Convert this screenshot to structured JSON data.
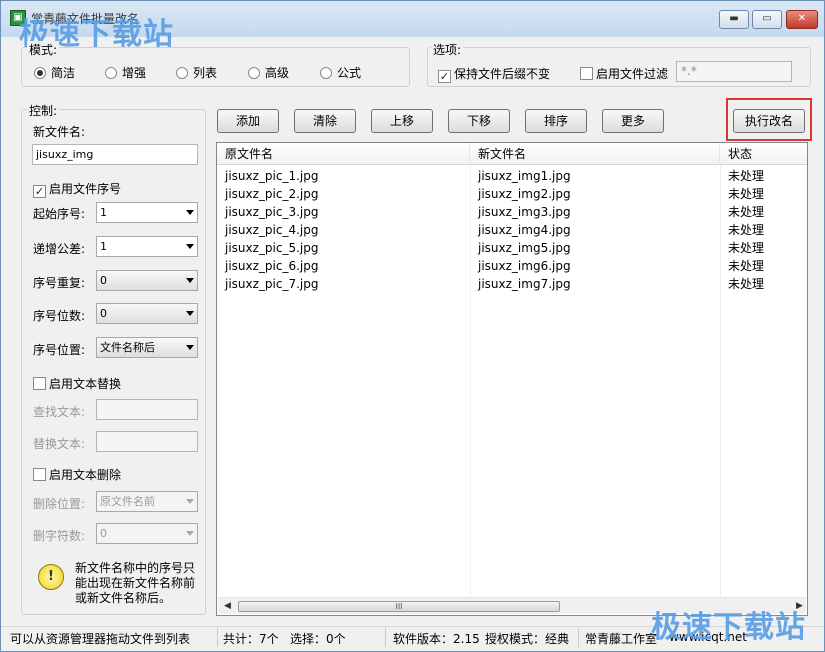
{
  "window": {
    "title": "常青藤文件批量改名",
    "watermark": "极速下载站",
    "controls": {
      "minimize": "▬",
      "maximize": "▭",
      "close": "✕"
    }
  },
  "mode": {
    "legend": "模式:",
    "options": [
      "简洁",
      "增强",
      "列表",
      "高级",
      "公式"
    ],
    "selected": "简洁"
  },
  "options": {
    "legend": "选项:",
    "keep_suffix": {
      "label": "保持文件后缀不变",
      "checked": true
    },
    "enable_filter": {
      "label": "启用文件过滤",
      "checked": false
    },
    "filter_value": "*.*"
  },
  "control": {
    "legend": "控制:",
    "new_name_label": "新文件名:",
    "new_name_value": "jisuxz_img",
    "enable_seq": {
      "label": "启用文件序号",
      "checked": true
    },
    "start_label": "起始序号:",
    "start_value": "1",
    "step_label": "递增公差:",
    "step_value": "1",
    "repeat_label": "序号重复:",
    "repeat_value": "0",
    "digits_label": "序号位数:",
    "digits_value": "0",
    "position_label": "序号位置:",
    "position_value": "文件名称后",
    "enable_replace": {
      "label": "启用文本替换",
      "checked": false
    },
    "find_label": "查找文本:",
    "replace_label": "替换文本:",
    "enable_delete": {
      "label": "启用文本删除",
      "checked": false
    },
    "delete_pos_label": "删除位置:",
    "delete_pos_value": "原文件名前",
    "delete_count_label": "删字符数:",
    "delete_count_value": "0",
    "tip_line1": "新文件名称中的序号只",
    "tip_line2": "能出现在新文件名称前",
    "tip_line3": "或新文件名称后。"
  },
  "toolbar": {
    "add": "添加",
    "clear": "清除",
    "move_up": "上移",
    "move_down": "下移",
    "sort": "排序",
    "more": "更多",
    "execute": "执行改名"
  },
  "table": {
    "headers": [
      "原文件名",
      "新文件名",
      "状态"
    ],
    "rows": [
      [
        "jisuxz_pic_1.jpg",
        "jisuxz_img1.jpg",
        "未处理"
      ],
      [
        "jisuxz_pic_2.jpg",
        "jisuxz_img2.jpg",
        "未处理"
      ],
      [
        "jisuxz_pic_3.jpg",
        "jisuxz_img3.jpg",
        "未处理"
      ],
      [
        "jisuxz_pic_4.jpg",
        "jisuxz_img4.jpg",
        "未处理"
      ],
      [
        "jisuxz_pic_5.jpg",
        "jisuxz_img5.jpg",
        "未处理"
      ],
      [
        "jisuxz_pic_6.jpg",
        "jisuxz_img6.jpg",
        "未处理"
      ],
      [
        "jisuxz_pic_7.jpg",
        "jisuxz_img7.jpg",
        "未处理"
      ]
    ],
    "scroll_grip": "III"
  },
  "status": {
    "hint": "可以从资源管理器拖动文件到列表",
    "total": "共计：7个",
    "selected": "选择：0个",
    "version": "软件版本：2.15",
    "license": "授权模式：经典",
    "studio": "常青藤工作室",
    "url": "www.icqt.net"
  }
}
